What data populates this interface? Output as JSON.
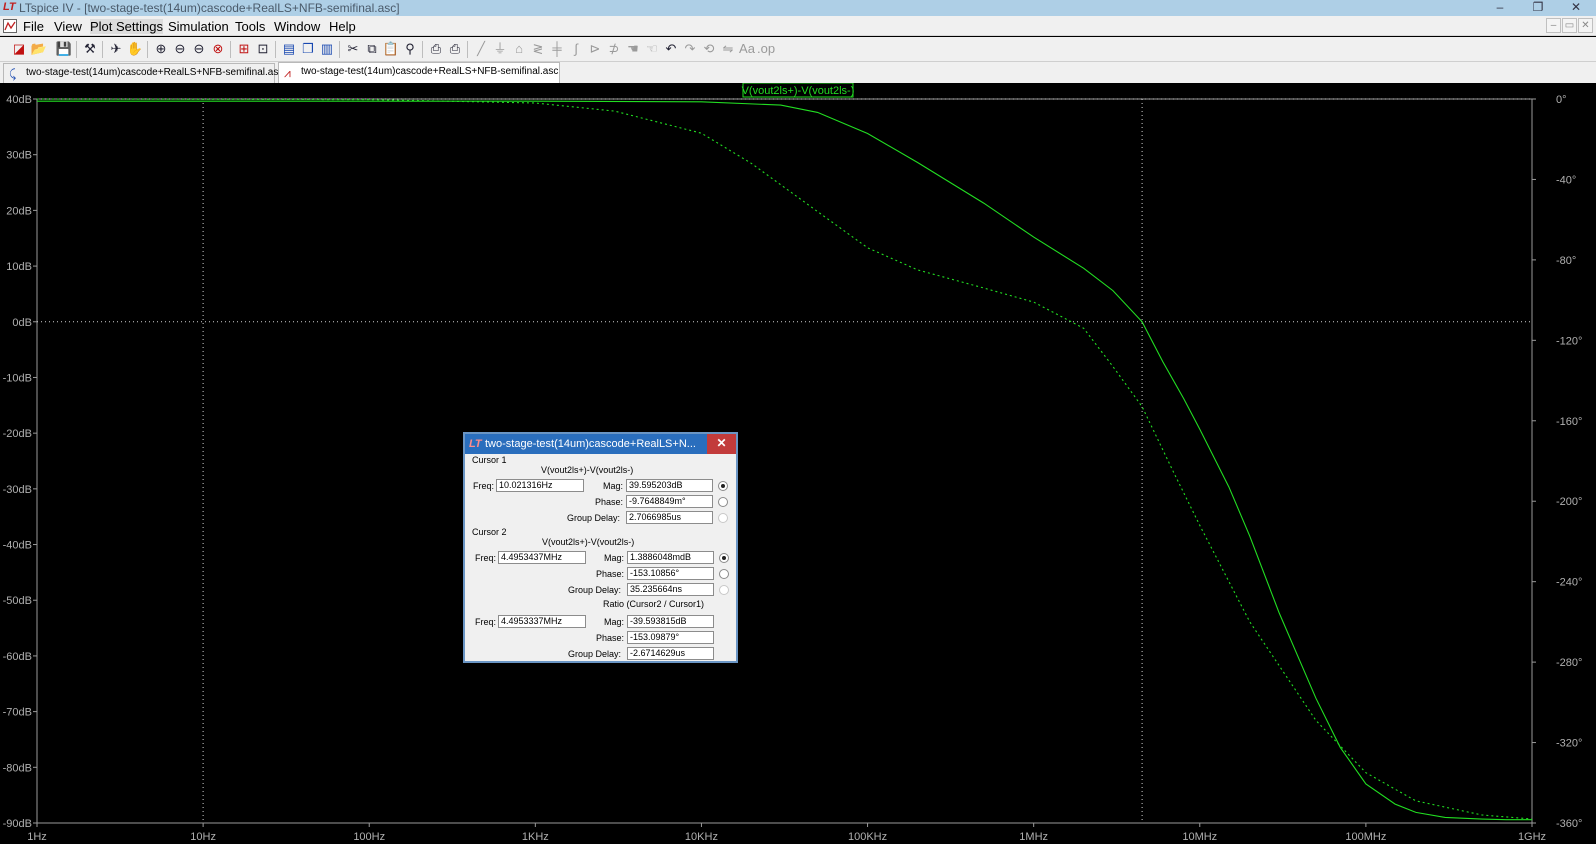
{
  "window": {
    "title": "LTspice IV - [two-stage-test(14um)cascode+RealLS+NFB-semifinal.asc]",
    "controls": [
      "–",
      "❐",
      "✕"
    ]
  },
  "menu": {
    "items": [
      "File",
      "View",
      "Plot Settings",
      "Simulation",
      "Tools",
      "Window",
      "Help"
    ],
    "mdi_controls": [
      "–",
      "▭",
      "✕"
    ]
  },
  "tabs": [
    {
      "label": "two-stage-test(14um)cascode+RealLS+NFB-semifinal.asc",
      "kind": "schematic"
    },
    {
      "label": "two-stage-test(14um)cascode+RealLS+NFB-semifinal.asc",
      "kind": "waveform"
    }
  ],
  "chart_data": {
    "type": "line",
    "trace_label": "V(vout2ls+)-V(vout2ls-)",
    "x_scale": "log",
    "xlim": [
      1,
      1000000000
    ],
    "x_ticks": [
      "1Hz",
      "10Hz",
      "100Hz",
      "1KHz",
      "10KHz",
      "100KHz",
      "1MHz",
      "10MHz",
      "100MHz",
      "1GHz"
    ],
    "y_ticks_left": [
      "40dB",
      "30dB",
      "20dB",
      "10dB",
      "0dB",
      "-10dB",
      "-20dB",
      "-30dB",
      "-40dB",
      "-50dB",
      "-60dB",
      "-70dB",
      "-80dB",
      "-90dB"
    ],
    "ylim_left": [
      -90,
      40
    ],
    "y_ticks_right": [
      "0°",
      "-40°",
      "-80°",
      "-120°",
      "-160°",
      "-200°",
      "-240°",
      "-280°",
      "-320°",
      "-360°"
    ],
    "ylim_right": [
      -360,
      0
    ],
    "series": [
      {
        "style": "solid",
        "axis": "left",
        "color": "#22dd22",
        "x": [
          1,
          100,
          1000,
          10000,
          30000,
          50000,
          100000,
          200000,
          500000,
          1000000,
          2000000,
          3000000,
          4495344,
          6000000,
          8000000,
          10000000,
          15000000,
          20000000,
          30000000,
          50000000,
          70000000,
          100000000,
          150000000,
          200000000,
          300000000,
          500000000,
          700000000,
          1000000000
        ],
        "y": [
          39.6,
          39.6,
          39.6,
          39.5,
          38.9,
          37.6,
          33.8,
          28.6,
          21.3,
          15.2,
          9.6,
          5.6,
          0,
          -7.2,
          -13.8,
          -19.3,
          -29.7,
          -38.5,
          -52.2,
          -67.6,
          -76.4,
          -83,
          -86.6,
          -88.1,
          -89.0,
          -89.3,
          -89.4,
          -89.4
        ]
      },
      {
        "style": "dashed",
        "axis": "right",
        "color": "#22dd22",
        "x": [
          1,
          100,
          1000,
          3000,
          10000,
          20000,
          50000,
          100000,
          200000,
          500000,
          1000000,
          2000000,
          3000000,
          4495344,
          7000000,
          10000000,
          20000000,
          50000000,
          100000000,
          200000000,
          500000000,
          1000000000
        ],
        "y": [
          0,
          -0.3,
          -2,
          -6,
          -17,
          -32,
          -56,
          -74,
          -85,
          -94,
          -101,
          -114,
          -133,
          -153,
          -186,
          -212,
          -260,
          -309,
          -335,
          -349,
          -356,
          -358
        ]
      }
    ],
    "cursor_freq_hz": 4495344
  },
  "cursor_dialog": {
    "title": "two-stage-test(14um)cascode+RealLS+N...",
    "close": "✕",
    "cursor1": {
      "heading": "Cursor 1",
      "trace": "V(vout2ls+)-V(vout2ls-)",
      "freq_label": "Freq:",
      "freq": "10.021316Hz",
      "mag_label": "Mag:",
      "mag": "39.595203dB",
      "phase_label": "Phase:",
      "phase": "-9.7648849m°",
      "gd_label": "Group Delay:",
      "gd": "2.7066985us"
    },
    "cursor2": {
      "heading": "Cursor 2",
      "trace": "V(vout2ls+)-V(vout2ls-)",
      "freq_label": "Freq:",
      "freq": "4.4953437MHz",
      "mag_label": "Mag:",
      "mag": "1.3886048mdB",
      "phase_label": "Phase:",
      "phase": "-153.10856°",
      "gd_label": "Group Delay:",
      "gd": "35.235664ns"
    },
    "ratio": {
      "heading": "Ratio (Cursor2 / Cursor1)",
      "freq_label": "Freq:",
      "freq": "4.4953337MHz",
      "mag_label": "Mag:",
      "mag": "-39.593815dB",
      "phase_label": "Phase:",
      "phase": "-153.09879°",
      "gd_label": "Group Delay:",
      "gd": "-2.6714629us"
    }
  },
  "toolbar": {
    "icons": [
      "new-schematic-icon",
      "open-icon",
      "save-icon",
      "control-panel-icon",
      "run-icon",
      "halt-icon",
      "zoom-in-icon",
      "zoom-out-icon",
      "zoom-out-2-icon",
      "zoom-cancel-icon",
      "autorange-icon",
      "measure-icon",
      "tile-horizontal-icon",
      "cascade-icon",
      "tile-vertical-icon",
      "cut-icon",
      "copy-icon",
      "paste-icon",
      "find-icon",
      "print-preview-icon",
      "print-icon",
      "wire-icon",
      "ground-icon",
      "label-net-icon",
      "resistor-icon",
      "capacitor-icon",
      "inductor-icon",
      "diode-icon",
      "component-icon",
      "move-icon",
      "drag-icon",
      "undo-icon",
      "redo-icon",
      "rotate-icon",
      "mirror-icon",
      "text-icon",
      "spice-directive-icon"
    ]
  }
}
